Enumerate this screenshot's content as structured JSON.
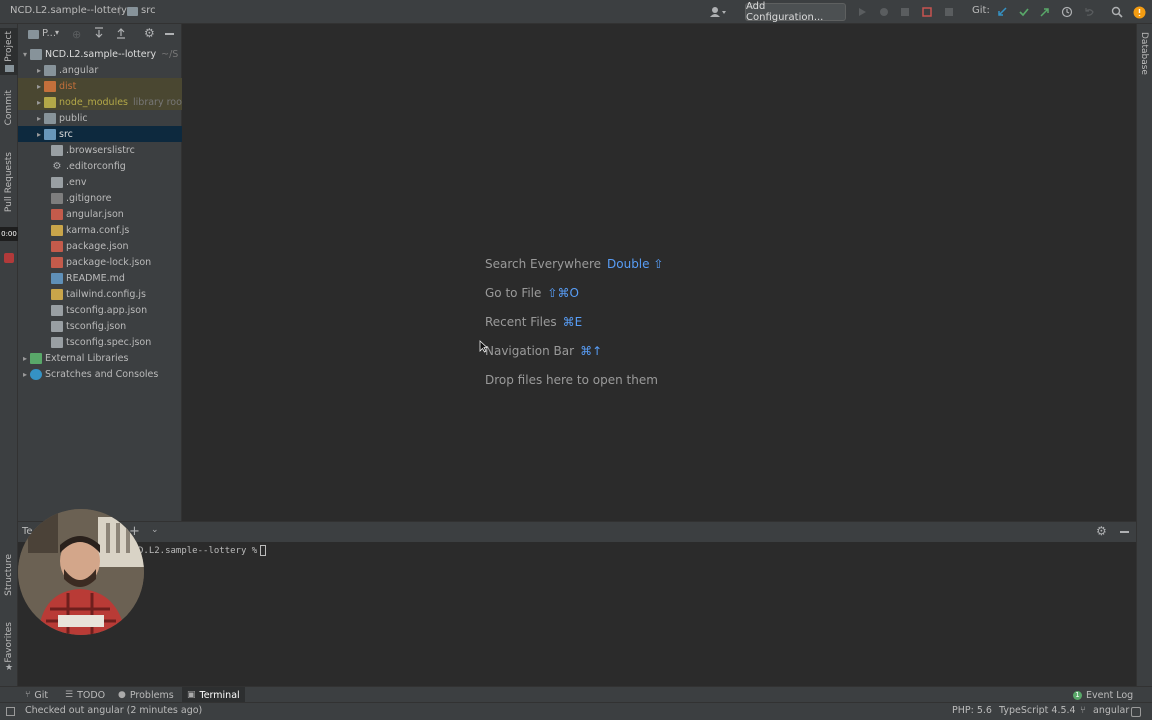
{
  "navbar": {
    "project_name": "NCD.L2.sample--lottery",
    "current_folder": "src",
    "add_configuration": "Add Configuration...",
    "git_label": "Git:"
  },
  "left_stripe": {
    "project_tab": "Project",
    "commit_tab": "Commit",
    "pull_requests_tab": "Pull Requests",
    "timer": "0:00",
    "structure_tab": "Structure",
    "favorites_tab": "Favorites"
  },
  "right_stripe": {
    "database_tab": "Database"
  },
  "project_panel": {
    "header_label": "P...",
    "root": {
      "name": "NCD.L2.sample--lottery",
      "path_hint": "~/S"
    },
    "items": [
      {
        "name": ".angular",
        "kind": "folder"
      },
      {
        "name": "dist",
        "kind": "folder"
      },
      {
        "name": "node_modules",
        "kind": "folder",
        "hint": "library root"
      },
      {
        "name": "public",
        "kind": "folder"
      },
      {
        "name": "src",
        "kind": "folder"
      },
      {
        "name": ".browserslistrc",
        "kind": "file"
      },
      {
        "name": ".editorconfig",
        "kind": "file"
      },
      {
        "name": ".env",
        "kind": "file"
      },
      {
        "name": ".gitignore",
        "kind": "file"
      },
      {
        "name": "angular.json",
        "kind": "file"
      },
      {
        "name": "karma.conf.js",
        "kind": "file"
      },
      {
        "name": "package.json",
        "kind": "file"
      },
      {
        "name": "package-lock.json",
        "kind": "file"
      },
      {
        "name": "README.md",
        "kind": "file"
      },
      {
        "name": "tailwind.config.js",
        "kind": "file"
      },
      {
        "name": "tsconfig.app.json",
        "kind": "file"
      },
      {
        "name": "tsconfig.json",
        "kind": "file"
      },
      {
        "name": "tsconfig.spec.json",
        "kind": "file"
      }
    ],
    "external_libraries": "External Libraries",
    "scratches": "Scratches and Consoles"
  },
  "editor_hints": [
    {
      "label": "Search Everywhere",
      "key": "Double ⇧"
    },
    {
      "label": "Go to File",
      "key": "⇧⌘O"
    },
    {
      "label": "Recent Files",
      "key": "⌘E"
    },
    {
      "label": "Navigation Bar",
      "key": "⌘↑"
    },
    {
      "label": "Drop files here to open them",
      "key": ""
    }
  ],
  "terminal": {
    "header_label": "Te",
    "prompt": "D.L2.sample--lottery %"
  },
  "bottom_tools": {
    "git": "Git",
    "todo": "TODO",
    "problems": "Problems",
    "terminal": "Terminal",
    "event_log": "Event Log",
    "event_count": "1"
  },
  "status_bar": {
    "message": "Checked out angular (2 minutes ago)",
    "php": "PHP: 5.6",
    "typescript": "TypeScript 4.5.4",
    "branch": "angular"
  },
  "colors": {
    "accent_blue": "#589df6",
    "excluded_folder": "#c4703b",
    "library_root": "#b3a848",
    "git_check": "#59a869"
  }
}
